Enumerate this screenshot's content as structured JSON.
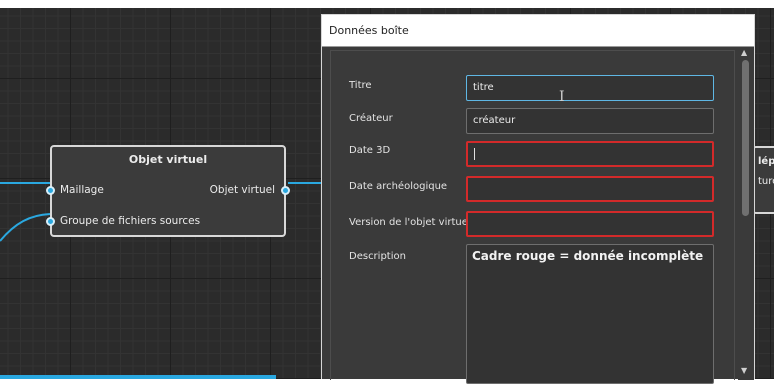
{
  "graph": {
    "node": {
      "title": "Objet virtuel",
      "input_1": "Maillage",
      "input_2": "Groupe de fichiers sources",
      "output": "Objet virtuel"
    },
    "node_partial": {
      "title_fragment": "lépo",
      "label_fragment": "ture"
    }
  },
  "dialog": {
    "title": "Données boîte",
    "fields": {
      "titre_label": "Titre",
      "titre_value": "titre",
      "createur_label": "Créateur",
      "createur_value": "créateur",
      "date3d_label": "Date 3D",
      "date_arch_label": "Date archéologique",
      "version_label": "Version de l'objet virtuel",
      "description_label": "Description",
      "description_value": "Cadre rouge = donnée incomplète"
    },
    "colors": {
      "error_border": "#d32a2a",
      "focus_border": "#5fb7e4",
      "accent": "#2aa8e0"
    }
  }
}
